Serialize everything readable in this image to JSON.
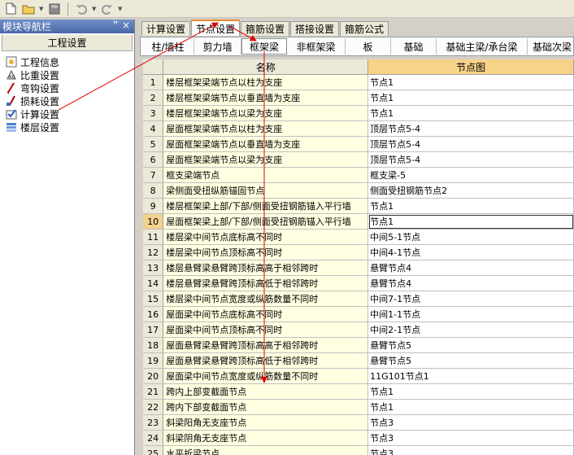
{
  "left_panel": {
    "title": "模块导航栏",
    "pin": "ꟸ",
    "close": "×",
    "header": "工程设置",
    "items": [
      {
        "label": "工程信息",
        "icon": "info-icon"
      },
      {
        "label": "比重设置",
        "icon": "weight-icon"
      },
      {
        "label": "弯钩设置",
        "icon": "hook-icon"
      },
      {
        "label": "损耗设置",
        "icon": "loss-icon"
      },
      {
        "label": "计算设置",
        "icon": "calc-settings-icon"
      },
      {
        "label": "楼层设置",
        "icon": "floors-icon"
      }
    ]
  },
  "tabs": [
    "计算设置",
    "节点设置",
    "箍筋设置",
    "搭接设置",
    "箍筋公式"
  ],
  "active_tab": 1,
  "subtabs": [
    "柱/墙柱",
    "剪力墙",
    "框架梁",
    "非框架梁",
    "板",
    "基础",
    "基础主梁/承台梁",
    "基础次梁"
  ],
  "active_subtab": 2,
  "grid": {
    "col_name": "名称",
    "col_node": "节点图",
    "selected_row": 10,
    "rows": [
      {
        "n": "1",
        "name": "楼层框架梁端节点以柱为支座",
        "node": "节点1"
      },
      {
        "n": "2",
        "name": "楼层框架梁端节点以垂直墙为支座",
        "node": "节点1"
      },
      {
        "n": "3",
        "name": "楼层框架梁端节点以梁为支座",
        "node": "节点1"
      },
      {
        "n": "4",
        "name": "屋面框架梁端节点以柱为支座",
        "node": "顶层节点5-4"
      },
      {
        "n": "5",
        "name": "屋面框架梁端节点以垂直墙为支座",
        "node": "顶层节点5-4"
      },
      {
        "n": "6",
        "name": "屋面框架梁端节点以梁为支座",
        "node": "顶层节点5-4"
      },
      {
        "n": "7",
        "name": "框支梁端节点",
        "node": "框支梁-5"
      },
      {
        "n": "8",
        "name": "梁侧面受扭纵筋锚固节点",
        "node": "侧面受扭钢筋节点2"
      },
      {
        "n": "9",
        "name": "楼层框架梁上部/下部/侧面受扭钢筋锚入平行墙",
        "node": "节点1"
      },
      {
        "n": "10",
        "name": "屋面框架梁上部/下部/侧面受扭钢筋锚入平行墙",
        "node": "节点1"
      },
      {
        "n": "11",
        "name": "楼层梁中间节点底标高不同时",
        "node": "中间5-1节点"
      },
      {
        "n": "12",
        "name": "楼层梁中间节点顶标高不同时",
        "node": "中间4-1节点"
      },
      {
        "n": "13",
        "name": "楼层悬臂梁悬臂跨顶标高高于相邻跨时",
        "node": "悬臂节点4"
      },
      {
        "n": "14",
        "name": "楼层悬臂梁悬臂跨顶标高低于相邻跨时",
        "node": "悬臂节点4"
      },
      {
        "n": "15",
        "name": "楼层梁中间节点宽度或纵筋数量不同时",
        "node": "中间7-1节点"
      },
      {
        "n": "16",
        "name": "屋面梁中间节点底标高不同时",
        "node": "中间1-1节点"
      },
      {
        "n": "17",
        "name": "屋面梁中间节点顶标高不同时",
        "node": "中间2-1节点"
      },
      {
        "n": "18",
        "name": "屋面悬臂梁悬臂跨顶标高高于相邻跨时",
        "node": "悬臂节点5"
      },
      {
        "n": "19",
        "name": "屋面悬臂梁悬臂跨顶标高低于相邻跨时",
        "node": "悬臂节点5"
      },
      {
        "n": "20",
        "name": "屋面梁中间节点宽度或纵筋数量不同时",
        "node": "11G101节点1"
      },
      {
        "n": "21",
        "name": "跨内上部变截面节点",
        "node": "节点1"
      },
      {
        "n": "22",
        "name": "跨内下部变截面节点",
        "node": "节点1"
      },
      {
        "n": "23",
        "name": "斜梁阳角无支座节点",
        "node": "节点3"
      },
      {
        "n": "24",
        "name": "斜梁阴角无支座节点",
        "node": "节点3"
      },
      {
        "n": "25",
        "name": "水平折梁节点",
        "node": "节点3"
      }
    ]
  },
  "colors": {
    "accent": "#e68b2c",
    "annotation": "#e00000",
    "header_selected": "#f7d38a",
    "name_cell": "#ffffe1"
  }
}
